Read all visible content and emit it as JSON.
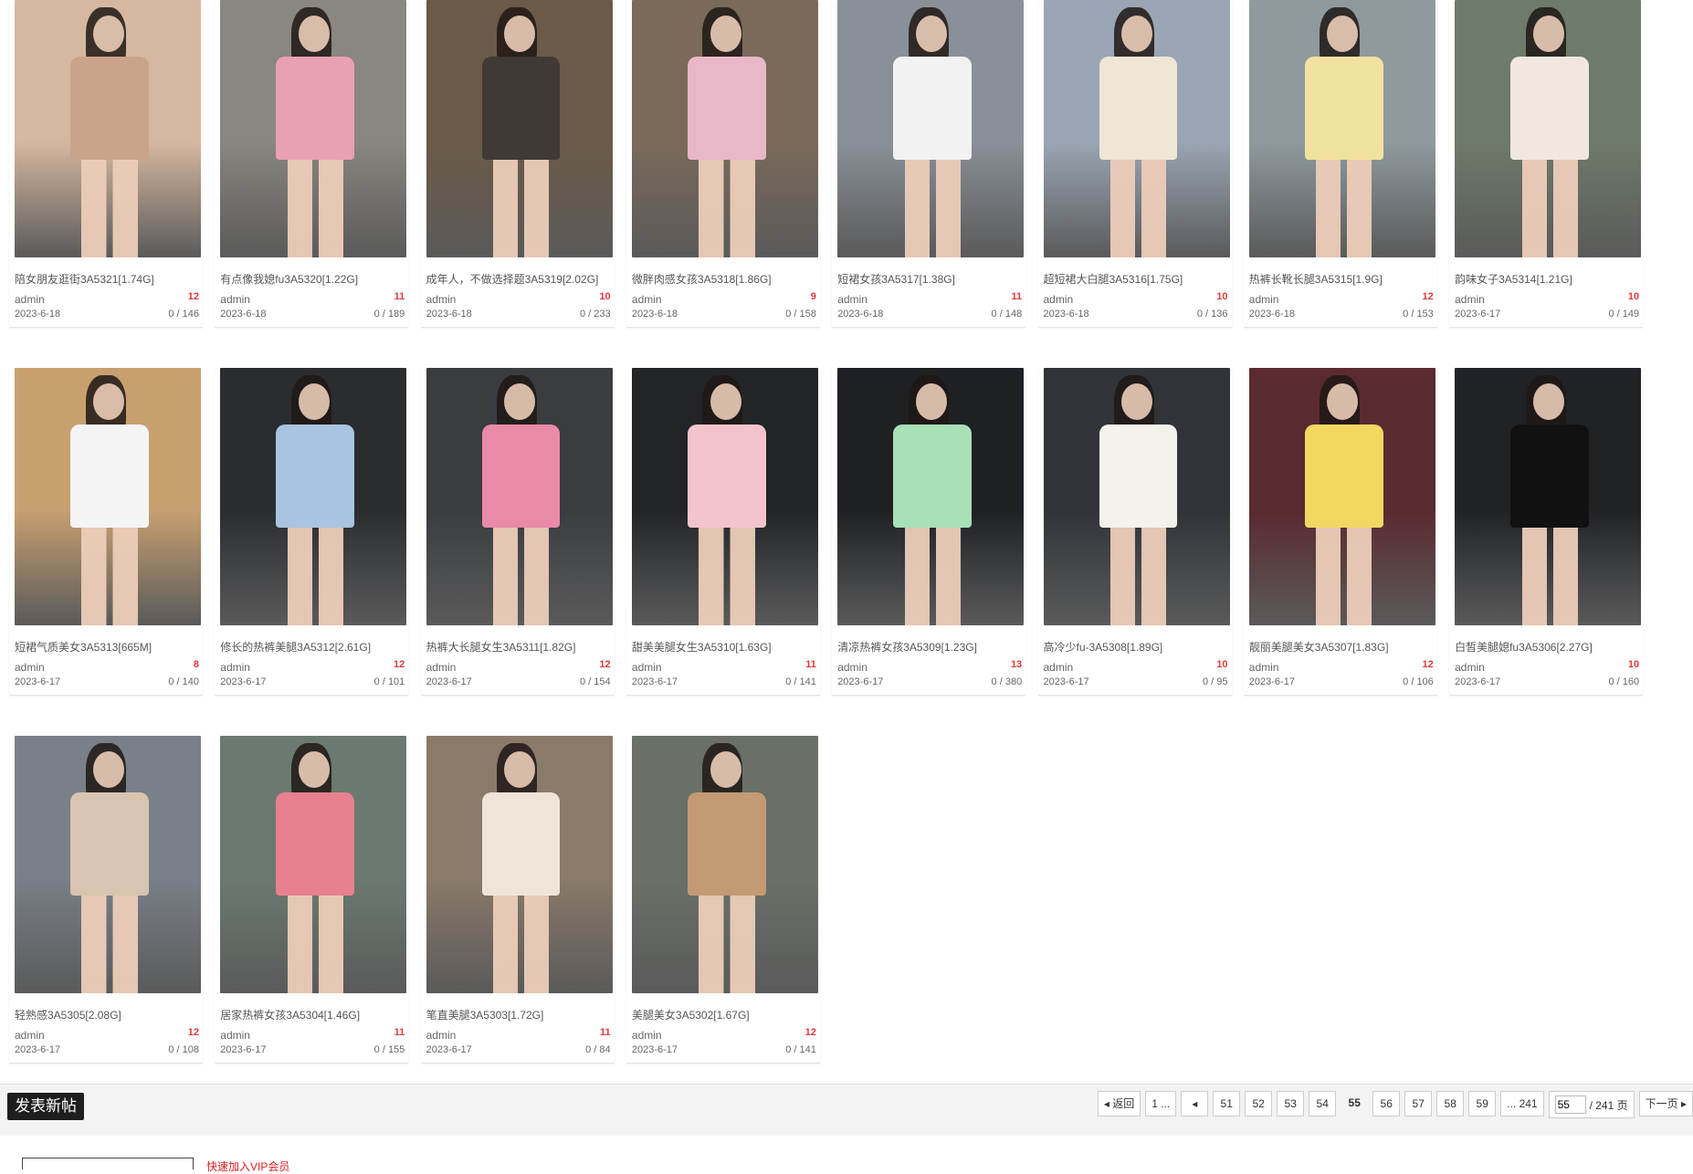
{
  "posts": [
    {
      "title": "陪女朋友逛街3A5321[1.74G]",
      "author": "admin",
      "count": "12",
      "date": "2023-6-18",
      "stats": "0 / 146",
      "colors": [
        "#d6b8a0",
        "#caa48a"
      ]
    },
    {
      "title": "有点像我媳fu3A5320[1.22G]",
      "author": "admin",
      "count": "11",
      "date": "2023-6-18",
      "stats": "0 / 189",
      "colors": [
        "#8a8680",
        "#e9a0b0"
      ]
    },
    {
      "title": "成年人，不做选择题3A5319[2.02G]",
      "author": "admin",
      "count": "10",
      "date": "2023-6-18",
      "stats": "0 / 233",
      "colors": [
        "#6b5a48",
        "#3f3a34"
      ]
    },
    {
      "title": "微胖肉感女孩3A5318[1.86G]",
      "author": "admin",
      "count": "9",
      "date": "2023-6-18",
      "stats": "0 / 158",
      "colors": [
        "#7a6a5a",
        "#e8b8c8"
      ]
    },
    {
      "title": "短裙女孩3A5317[1.38G]",
      "author": "admin",
      "count": "11",
      "date": "2023-6-18",
      "stats": "0 / 148",
      "colors": [
        "#8a9098",
        "#f2f2f2"
      ]
    },
    {
      "title": "超短裙大白腿3A5316[1.75G]",
      "author": "admin",
      "count": "10",
      "date": "2023-6-18",
      "stats": "0 / 136",
      "colors": [
        "#9aa6b4",
        "#f0e6d6"
      ]
    },
    {
      "title": "热裤长靴长腿3A5315[1.9G]",
      "author": "admin",
      "count": "12",
      "date": "2023-6-18",
      "stats": "0 / 153",
      "colors": [
        "#8f9a9e",
        "#f2e2a0"
      ]
    },
    {
      "title": "韵味女子3A5314[1.21G]",
      "author": "admin",
      "count": "10",
      "date": "2023-6-17",
      "stats": "0 / 149",
      "colors": [
        "#6e7a6a",
        "#f0e8e0"
      ]
    },
    {
      "title": "短裙气质美女3A5313[665M]",
      "author": "admin",
      "count": "8",
      "date": "2023-6-17",
      "stats": "0 / 140",
      "colors": [
        "#c8a070",
        "#f4f4f4"
      ]
    },
    {
      "title": "修长的热裤美腿3A5312[2.61G]",
      "author": "admin",
      "count": "12",
      "date": "2023-6-17",
      "stats": "0 / 101",
      "colors": [
        "#2a2c30",
        "#a8c4e0"
      ]
    },
    {
      "title": "热裤大长腿女生3A5311[1.82G]",
      "author": "admin",
      "count": "12",
      "date": "2023-6-17",
      "stats": "0 / 154",
      "colors": [
        "#3a3c40",
        "#e88aa8"
      ]
    },
    {
      "title": "甜美美腿女生3A5310[1.63G]",
      "author": "admin",
      "count": "11",
      "date": "2023-6-17",
      "stats": "0 / 141",
      "colors": [
        "#222428",
        "#f4c4cc"
      ]
    },
    {
      "title": "清凉热裤女孩3A5309[1.23G]",
      "author": "admin",
      "count": "13",
      "date": "2023-6-17",
      "stats": "0 / 380",
      "colors": [
        "#1e2024",
        "#a8e0b8"
      ]
    },
    {
      "title": "高冷少fu-3A5308[1.89G]",
      "author": "admin",
      "count": "10",
      "date": "2023-6-17",
      "stats": "0 / 95",
      "colors": [
        "#303438",
        "#f4f2ec"
      ]
    },
    {
      "title": "靓丽美腿美女3A5307[1.83G]",
      "author": "admin",
      "count": "12",
      "date": "2023-6-17",
      "stats": "0 / 106",
      "colors": [
        "#5a2a30",
        "#f2d860"
      ]
    },
    {
      "title": "白皙美腿媳fu3A5306[2.27G]",
      "author": "admin",
      "count": "10",
      "date": "2023-6-17",
      "stats": "0 / 160",
      "colors": [
        "#202226",
        "#111111"
      ]
    },
    {
      "title": "轻熟感3A5305[2.08G]",
      "author": "admin",
      "count": "12",
      "date": "2023-6-17",
      "stats": "0 / 108",
      "colors": [
        "#7a8088",
        "#d8c4b0"
      ]
    },
    {
      "title": "居家热裤女孩3A5304[1.46G]",
      "author": "admin",
      "count": "11",
      "date": "2023-6-17",
      "stats": "0 / 155",
      "colors": [
        "#6a7a70",
        "#e88090"
      ]
    },
    {
      "title": "笔直美腿3A5303[1.72G]",
      "author": "admin",
      "count": "11",
      "date": "2023-6-17",
      "stats": "0 / 84",
      "colors": [
        "#8a7a6a",
        "#f0e4d8"
      ]
    },
    {
      "title": "美腿美女3A5302[1.67G]",
      "author": "admin",
      "count": "12",
      "date": "2023-6-17",
      "stats": "0 / 141",
      "colors": [
        "#6a7068",
        "#c49a74"
      ]
    }
  ],
  "toolbar": {
    "new_post": "发表新帖"
  },
  "pager": {
    "back": "返回",
    "first": "1 ...",
    "pages": [
      "51",
      "52",
      "53",
      "54",
      "55",
      "56",
      "57",
      "58",
      "59"
    ],
    "current": "55",
    "last": "... 241",
    "input_value": "55",
    "total": "/ 241 页",
    "next": "下一页"
  },
  "footer": {
    "red_text": "快速加入VIP会员"
  },
  "colors": {
    "accent_red": "#e4393c",
    "dark_button": "#1e1e1e"
  }
}
